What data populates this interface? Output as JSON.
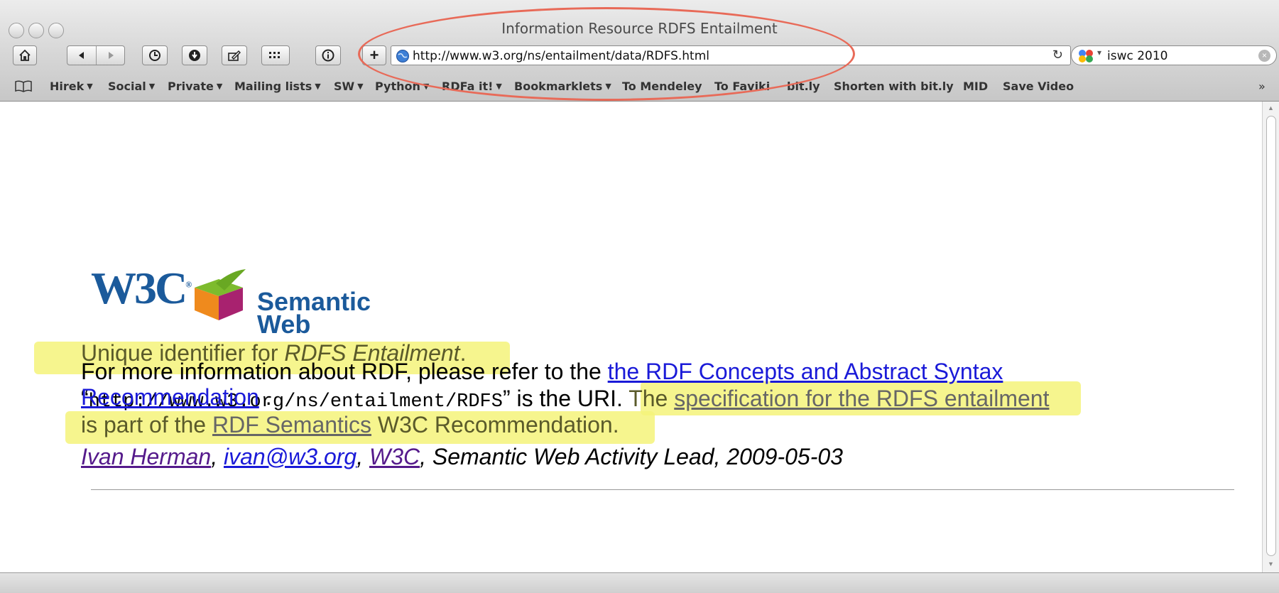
{
  "window": {
    "title": "Information Resource RDFS Entailment"
  },
  "toolbar": {
    "address": "http://www.w3.org/ns/entailment/data/RDFS.html",
    "search": "iswc 2010"
  },
  "bookmarks": [
    {
      "label": "Hirek",
      "menu": true
    },
    {
      "label": "Social",
      "menu": true
    },
    {
      "label": "Private",
      "menu": true
    },
    {
      "label": "Mailing lists",
      "menu": true
    },
    {
      "label": "SW",
      "menu": true
    },
    {
      "label": "Python",
      "menu": true
    },
    {
      "label": "RDFa it!",
      "menu": true
    },
    {
      "label": "Bookmarklets",
      "menu": true
    },
    {
      "label": "To Mendeley",
      "menu": false
    },
    {
      "label": "To Faviki",
      "menu": false
    },
    {
      "label": "bit.ly",
      "menu": false
    },
    {
      "label": "Shorten with bit.ly",
      "menu": false
    },
    {
      "label": "MID",
      "menu": false
    },
    {
      "label": "Save Video",
      "menu": false
    }
  ],
  "bookmarks_overflow": "»",
  "logo": {
    "w3c": "W3C",
    "sw_line1": "Semantic",
    "sw_line2": "Web"
  },
  "content": {
    "heading_prefix": "Unique identifier for ",
    "heading_em": "RDFS Entailment",
    "heading_suffix": ".",
    "uri": "http://www.w3.org/ns/entailment/RDFS",
    "uri_open": "“",
    "uri_close": "” is the URI. ",
    "spec_prefix": "The ",
    "spec_link": "specification for the RDFS entailment",
    "line2_prefix": "is part of the ",
    "semantics_link": "RDF Semantics",
    "line2_suffix": " W3C Recommendation.",
    "more_prefix": "For more information about RDF, please refer to the ",
    "concepts_link_1": "the RDF Concepts and Abstract Syntax",
    "concepts_link_2": "Recommendation",
    "more_suffix": " .",
    "footer_name": "Ivan Herman",
    "footer_sep1": ", ",
    "footer_email": "ivan@w3.org",
    "footer_sep2": ", ",
    "footer_org": "W3C",
    "footer_rest": ", Semantic Web Activity Lead, 2009-05-03"
  },
  "colors": {
    "highlight": "#f4f37a",
    "annotation": "#e86a58",
    "link": "#1a1ad8",
    "visited": "#551a8b"
  }
}
